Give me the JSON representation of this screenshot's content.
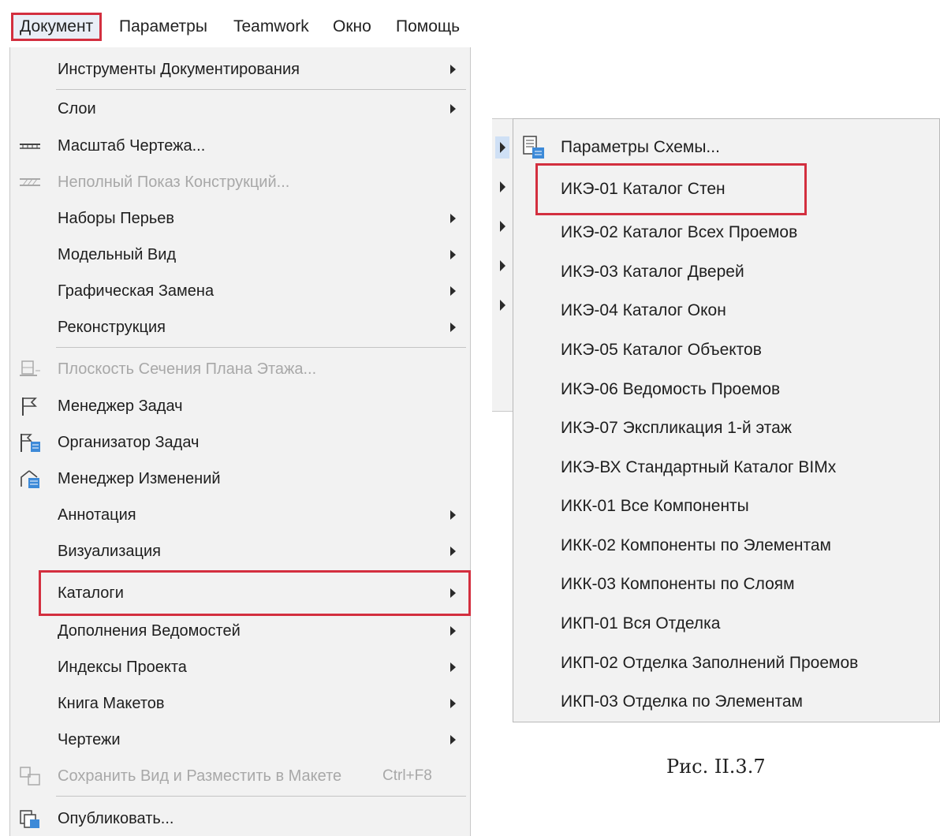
{
  "menubar": {
    "items": [
      "Документ",
      "Параметры",
      "Teamwork",
      "Окно",
      "Помощь"
    ]
  },
  "document_menu": {
    "items": [
      {
        "label": "Инструменты Документирования",
        "submenu": true
      },
      {
        "label": "Слои",
        "submenu": true
      },
      {
        "label": "Масштаб Чертежа...",
        "icon": "scale-ruler-icon"
      },
      {
        "label": "Неполный Показ Конструкций...",
        "icon": "partial-structure-icon",
        "disabled": true
      },
      {
        "label": "Наборы Перьев",
        "submenu": true
      },
      {
        "label": "Модельный Вид",
        "submenu": true
      },
      {
        "label": "Графическая Замена",
        "submenu": true
      },
      {
        "label": "Реконструкция",
        "submenu": true
      },
      {
        "label": "Плоскость Сечения Плана Этажа...",
        "icon": "floor-plan-cut-icon",
        "disabled": true
      },
      {
        "label": "Менеджер Задач",
        "icon": "flag-icon"
      },
      {
        "label": "Организатор Задач",
        "icon": "task-organizer-icon"
      },
      {
        "label": "Менеджер Изменений",
        "icon": "change-manager-icon"
      },
      {
        "label": "Аннотация",
        "submenu": true
      },
      {
        "label": "Визуализация",
        "submenu": true
      },
      {
        "label": "Каталоги",
        "submenu": true,
        "highlighted": true
      },
      {
        "label": "Дополнения Ведомостей",
        "submenu": true
      },
      {
        "label": "Индексы Проекта",
        "submenu": true
      },
      {
        "label": "Книга Макетов",
        "submenu": true
      },
      {
        "label": "Чертежи",
        "submenu": true
      },
      {
        "label": "Сохранить Вид и Разместить в Макете",
        "shortcut": "Ctrl+F8",
        "icon": "save-view-icon",
        "disabled": true
      },
      {
        "label": "Опубликовать...",
        "icon": "publish-icon"
      }
    ]
  },
  "catalog_submenu": {
    "items": [
      {
        "label": "Параметры Схемы...",
        "icon": "scheme-settings-icon"
      },
      {
        "label": "ИКЭ-01 Каталог Стен",
        "highlighted": true
      },
      {
        "label": "ИКЭ-02 Каталог Всех Проемов"
      },
      {
        "label": "ИКЭ-03 Каталог Дверей"
      },
      {
        "label": "ИКЭ-04 Каталог Окон"
      },
      {
        "label": "ИКЭ-05 Каталог Объектов"
      },
      {
        "label": "ИКЭ-06 Ведомость Проемов"
      },
      {
        "label": "ИКЭ-07 Экспликация 1-й этаж"
      },
      {
        "label": "ИКЭ-ВХ Стандартный Каталог BIMx"
      },
      {
        "label": "ИКК-01 Все Компоненты"
      },
      {
        "label": "ИКК-02 Компоненты по Элементам"
      },
      {
        "label": "ИКК-03 Компоненты по Слоям"
      },
      {
        "label": "ИКП-01 Вся Отделка"
      },
      {
        "label": "ИКП-02 Отделка Заполнений Проемов"
      },
      {
        "label": "ИКП-03 Отделка по Элементам"
      }
    ]
  },
  "caption": "Рис. II.3.7",
  "colors": {
    "highlight_border": "#d32f3f",
    "menu_bg": "#f2f2f2"
  }
}
